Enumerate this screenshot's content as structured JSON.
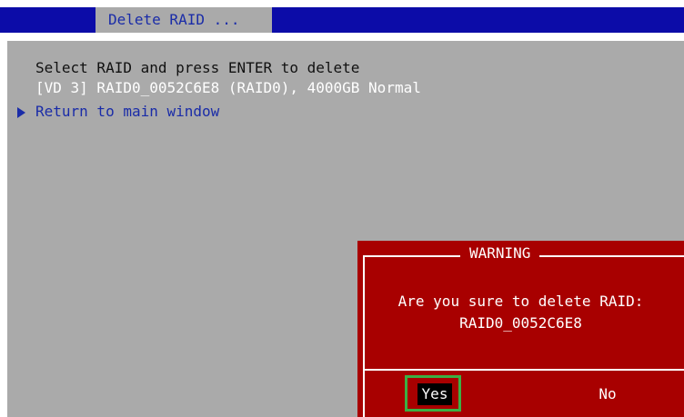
{
  "header": {
    "title": "Delete RAID ..."
  },
  "main": {
    "instruction": "Select RAID and press ENTER to delete",
    "raid_item": "[VD 3] RAID0_0052C6E8 (RAID0), 4000GB Normal",
    "return_label": "Return to main window",
    "return_icon": "triangle-right-icon"
  },
  "dialog": {
    "title": "WARNING",
    "message_line1": "Are you sure to delete RAID:",
    "message_line2": "RAID0_0052C6E8",
    "yes_label": "Yes",
    "no_label": "No"
  },
  "colors": {
    "top_bar": "#0c0ca8",
    "background": "#aaaaaa",
    "accent_text": "#1a2ca8",
    "dialog": "#a80000",
    "focus_ring": "#3bb044"
  }
}
